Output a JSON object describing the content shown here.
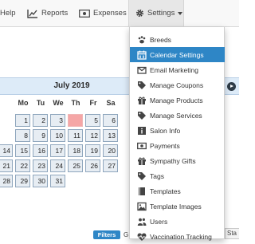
{
  "nav": {
    "help_label": "Help",
    "reports_label": "Reports",
    "expenses_label": "Expenses",
    "settings_label": "Settings"
  },
  "calendar": {
    "title": "July 2019",
    "weekdays": [
      "Mo",
      "Tu",
      "We",
      "Th",
      "Fr",
      "Sa"
    ],
    "days": [
      "1",
      "2",
      "3",
      "4",
      "5",
      "6",
      "8",
      "9",
      "10",
      "11",
      "12",
      "13",
      "14",
      "15",
      "16",
      "17",
      "18",
      "19",
      "20",
      "21",
      "22",
      "23",
      "24",
      "25",
      "26",
      "27",
      "28",
      "29",
      "30",
      "31"
    ],
    "today": "4"
  },
  "settings_menu": {
    "items": [
      {
        "label": "Breeds",
        "icon": "paw-icon"
      },
      {
        "label": "Calendar Settings",
        "icon": "calendar-icon",
        "active": true
      },
      {
        "label": "Email Marketing",
        "icon": "envelope-icon"
      },
      {
        "label": "Manage Coupons",
        "icon": "tag-icon"
      },
      {
        "label": "Manage Products",
        "icon": "gift-icon"
      },
      {
        "label": "Manage Services",
        "icon": "tag-icon"
      },
      {
        "label": "Salon Info",
        "icon": "info-icon"
      },
      {
        "label": "Payments",
        "icon": "money-icon"
      },
      {
        "label": "Sympathy Gifts",
        "icon": "gift-icon"
      },
      {
        "label": "Tags",
        "icon": "tag-icon"
      },
      {
        "label": "Templates",
        "icon": "book-icon"
      },
      {
        "label": "Template Images",
        "icon": "image-icon"
      },
      {
        "label": "Users",
        "icon": "users-icon"
      },
      {
        "label": "Vaccination Tracking",
        "icon": "heartbeat-icon"
      }
    ]
  },
  "bottom": {
    "filters_label": "Filters",
    "partial_label": "G",
    "partial_right_label": "Sta"
  },
  "colors": {
    "accent": "#2e86c6",
    "today_cell": "#f5a6a6",
    "calendar_header": "#ddebf8"
  }
}
